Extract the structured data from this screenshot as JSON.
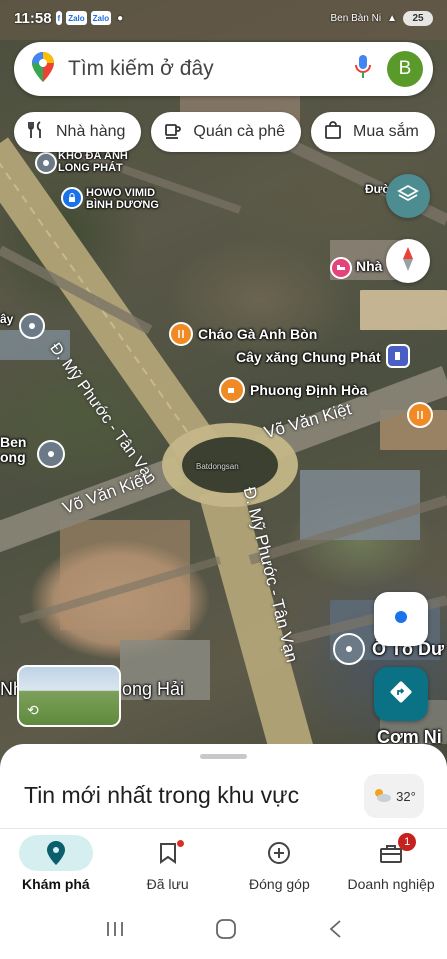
{
  "status_bar": {
    "time": "11:58",
    "carrier_text": "Ben Bàn Ni",
    "battery": "25"
  },
  "search": {
    "placeholder": "Tìm kiếm ở đây",
    "avatar_letter": "B"
  },
  "chips": [
    {
      "label": "Nhà hàng",
      "icon": "fork-knife-icon"
    },
    {
      "label": "Quán cà phê",
      "icon": "coffee-cup-icon"
    },
    {
      "label": "Mua sắm",
      "icon": "shopping-bag-icon"
    }
  ],
  "map": {
    "places": {
      "kho": "KHO ĐÁ ANH\nLONG PHÁT",
      "howo": "HOWO VIMID\nBÌNH DƯƠNG",
      "duong": "Đường",
      "nha": "Nhà",
      "chao": "Cháo Gà Anh Bòn",
      "cayxang": "Cây xăng Chung Phát",
      "phuong": "Phuong Định Hòa",
      "ben": "Ben\nong",
      "ay": "ây",
      "oto": "Ô Tô Dư",
      "com": "Cơm Ni",
      "hai": "ong Hải",
      "nh": "Nh",
      "watermark": "Batdongsan"
    },
    "roads": {
      "my_phuoc_1": "Đ. Mỹ Phước - Tân Vạn",
      "my_phuoc_2": "Đ. Mỹ Phước - Tân Vạn",
      "vo_van_kiet_1": "Võ Văn Kiệt",
      "vo_van_kiet_2": "Võ Văn Kiệt"
    }
  },
  "sheet": {
    "title": "Tin mới nhất trong khu vực",
    "temperature": "32°"
  },
  "bottom_nav": [
    {
      "label": "Khám phá",
      "icon": "explore-pin-icon",
      "active": true
    },
    {
      "label": "Đã lưu",
      "icon": "bookmark-icon",
      "active": false
    },
    {
      "label": "Đóng góp",
      "icon": "add-circle-icon",
      "active": false
    },
    {
      "label": "Doanh nghiệp",
      "icon": "store-icon",
      "active": false,
      "badge": "1"
    }
  ],
  "colors": {
    "accent": "#1a73e8",
    "teal_fab": "#0b7285",
    "active_nav": "#d5eef0",
    "map_pin_orange": "#f08a24"
  }
}
